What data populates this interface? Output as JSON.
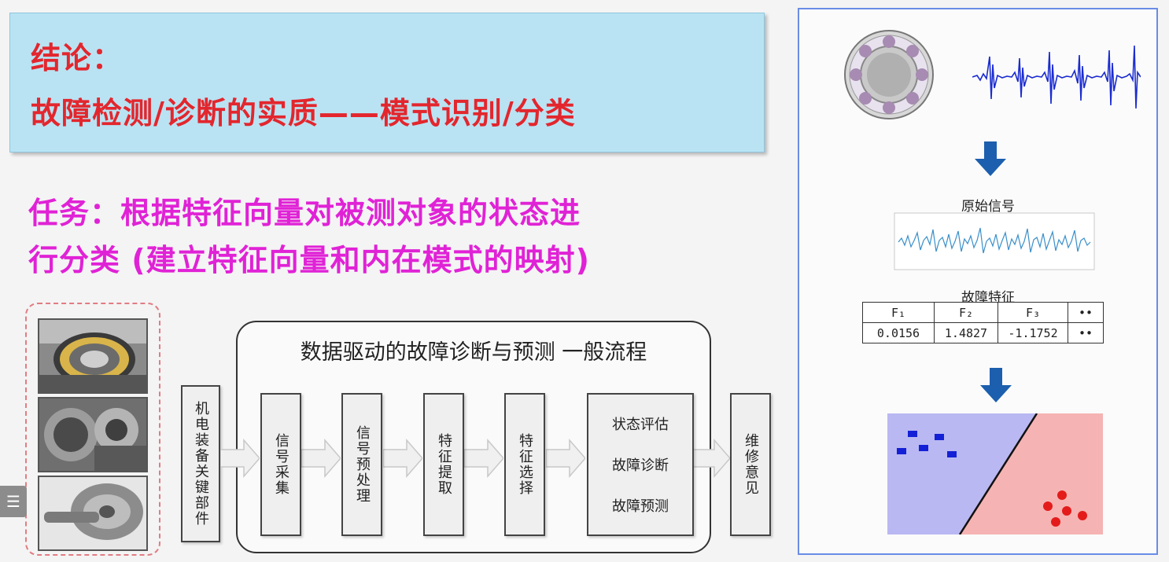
{
  "conclusion": {
    "line1": "结论：",
    "line2": "故障检测/诊断的实质——模式识别/分类"
  },
  "task": {
    "line1": "任务：根据特征向量对被测对象的状态进",
    "line2": "行分类 (建立特征向量和内在模式的映射)"
  },
  "side_tab": "☰",
  "flow": {
    "title": "数据驱动的故障诊断与预测  一般流程",
    "input_label": "机电装备关键部件",
    "steps": [
      "信号采集",
      "信号预处理",
      "特征提取",
      "特征选择"
    ],
    "outcomes": [
      "状态评估",
      "故障诊断",
      "故障预测"
    ],
    "output_label": "维修意见"
  },
  "right_panel": {
    "raw_signal_label": "原始信号",
    "features_label": "故障特征",
    "feature_headers": [
      "F₁",
      "F₂",
      "F₃",
      "••"
    ],
    "feature_values": [
      "0.0156",
      "1.4827",
      "-1.1752",
      "••"
    ],
    "colors": {
      "class_a_bg": "#b9b8f2",
      "class_b_bg": "#f6b3b3",
      "class_a_points": "#1320d6",
      "class_b_points": "#e41b1b",
      "arrow": "#1c5fae"
    }
  },
  "colors": {
    "conclusion_text": "#e3262d",
    "task_text": "#e022d6",
    "conclusion_bg": "#b9e3f3"
  }
}
